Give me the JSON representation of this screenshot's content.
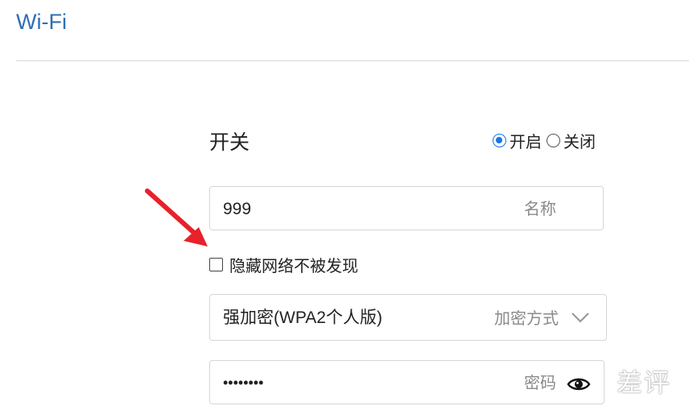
{
  "header": {
    "title": "Wi-Fi"
  },
  "switch": {
    "label": "开关",
    "options": [
      {
        "label": "开启",
        "selected": true
      },
      {
        "label": "关闭",
        "selected": false
      }
    ]
  },
  "name_field": {
    "value": "999",
    "hint": "名称"
  },
  "hide_network": {
    "label": "隐藏网络不被发现",
    "checked": false
  },
  "encryption": {
    "value": "强加密(WPA2个人版)",
    "hint": "加密方式",
    "icon": "chevron-down-icon"
  },
  "password": {
    "value": "••••••••",
    "hint": "密码",
    "icon": "eye-icon"
  },
  "annotation": {
    "icon": "red-arrow-icon",
    "color": "#e8212b"
  },
  "watermark": {
    "text": "差评"
  },
  "colors": {
    "title": "#2f6fb2",
    "radio_selected": "#1a73e8",
    "border": "#d6d6d6",
    "hint": "#8a8a8a"
  }
}
